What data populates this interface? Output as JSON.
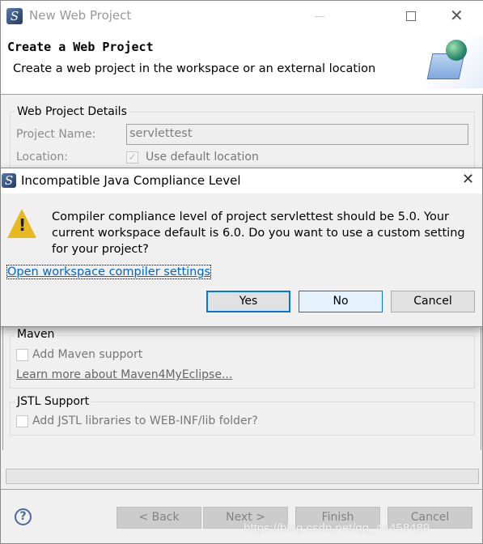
{
  "window": {
    "title": "New Web Project",
    "controls": [
      "minimize",
      "maximize",
      "close"
    ]
  },
  "header": {
    "title": "Create a Web Project",
    "subtitle": "Create a web project in the workspace or an external location",
    "icon": "folder-globe-icon"
  },
  "details": {
    "legend": "Web Project Details",
    "project_name_label": "Project Name:",
    "project_name_value": "servlettest",
    "location_label": "Location:",
    "use_default_label": "Use default location",
    "use_default_checked": true
  },
  "maven": {
    "legend": "Maven",
    "add_label": "Add Maven support",
    "add_checked": false,
    "learn_more": "Learn more about Maven4MyEclipse..."
  },
  "jstl": {
    "legend": "JSTL Support",
    "add_label": "Add JSTL libraries to WEB-INF/lib folder?",
    "add_checked": false
  },
  "footer": {
    "back": "< Back",
    "next": "Next >",
    "finish": "Finish",
    "cancel": "Cancel"
  },
  "dialog": {
    "title": "Incompatible Java Compliance Level",
    "message": "Compiler compliance level of project servlettest should be 5.0. Your current workspace default is 6.0. Do you want to use a custom setting for your project?",
    "link": "Open workspace compiler settings",
    "yes": "Yes",
    "no": "No",
    "cancel": "Cancel",
    "icon": "warning-icon"
  },
  "watermark": "https://blog.csdn.net/qq_44458489"
}
